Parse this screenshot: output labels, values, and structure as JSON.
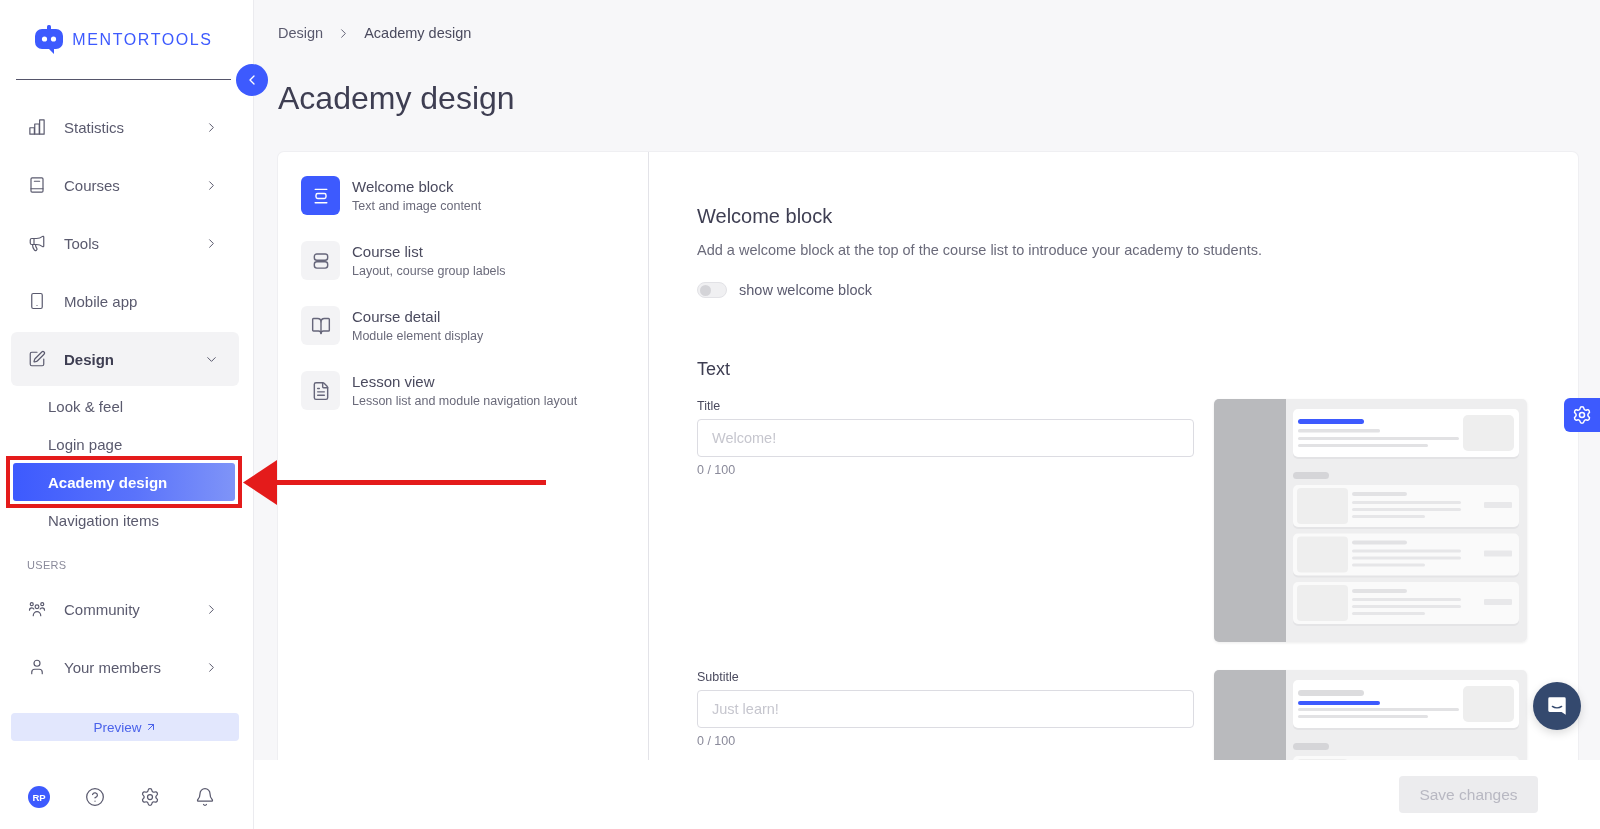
{
  "sidebar": {
    "logo_text": "MENTORTOOLS",
    "nav_sections": [
      {
        "items": [
          {
            "label": "Statistics",
            "kind": "group",
            "expanded": false
          },
          {
            "label": "Courses",
            "kind": "group",
            "expanded": false
          },
          {
            "label": "Tools",
            "kind": "group",
            "expanded": false
          },
          {
            "label": "Mobile app",
            "kind": "link",
            "expanded": false
          },
          {
            "label": "Design",
            "kind": "group",
            "expanded": true,
            "children": [
              {
                "label": "Look & feel",
                "selected": false
              },
              {
                "label": "Login page",
                "selected": false
              },
              {
                "label": "Academy design",
                "selected": true
              },
              {
                "label": "Navigation items",
                "selected": false
              }
            ]
          }
        ]
      },
      {
        "heading": "USERS",
        "items": [
          {
            "label": "Community",
            "kind": "group",
            "expanded": false
          },
          {
            "label": "Your members",
            "kind": "group",
            "expanded": false
          }
        ]
      }
    ],
    "preview_button": {
      "label": "Preview"
    },
    "avatar": {
      "initials": "RP"
    }
  },
  "breadcrumb": [
    {
      "label": "Design"
    },
    {
      "label": "Academy design"
    }
  ],
  "page_title": "Academy design",
  "settings_menu": [
    {
      "title": "Welcome block",
      "subtitle": "Text and image content",
      "selected": true
    },
    {
      "title": "Course list",
      "subtitle": "Layout, course group labels",
      "selected": false
    },
    {
      "title": "Course detail",
      "subtitle": "Module element display",
      "selected": false
    },
    {
      "title": "Lesson view",
      "subtitle": "Lesson list and module navigation layout",
      "selected": false
    }
  ],
  "section": {
    "title": "Welcome block",
    "description": "Add a welcome block at the top of the course list to introduce your academy to students.",
    "toggle": {
      "label": "show welcome block",
      "on": false
    }
  },
  "text_group": {
    "title": "Text",
    "fields": [
      {
        "label": "Title",
        "placeholder": "Welcome!",
        "counter": "0 / 100"
      },
      {
        "label": "Subtitle",
        "placeholder": "Just learn!",
        "counter": "0 / 100"
      }
    ]
  },
  "save_button": {
    "label": "Save changes",
    "disabled": true
  },
  "annotation": {
    "highlight_box": true,
    "arrow": true
  }
}
